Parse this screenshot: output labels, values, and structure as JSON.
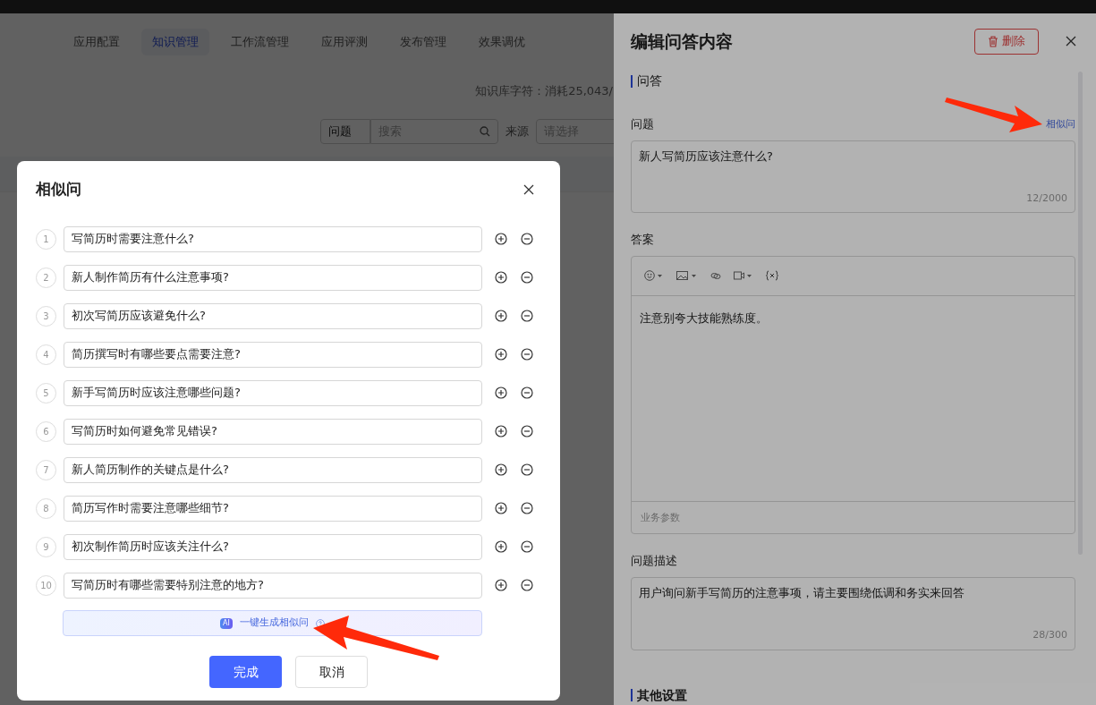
{
  "nav_tabs": [
    {
      "label": "应用配置",
      "selected": false
    },
    {
      "label": "知识管理",
      "selected": true
    },
    {
      "label": "工作流管理",
      "selected": false
    },
    {
      "label": "应用评测",
      "selected": false
    },
    {
      "label": "发布管理",
      "selected": false
    },
    {
      "label": "效果调优",
      "selected": false
    }
  ],
  "usage_text": "知识库字符：消耗25,043/",
  "filter": {
    "type_label": "问题",
    "search_placeholder": "搜索",
    "source_label": "来源",
    "source_placeholder": "请选择"
  },
  "drawer": {
    "title": "编辑问答内容",
    "delete_button": "删除",
    "section_title": "问答",
    "question": {
      "label": "问题",
      "similar_link": "相似问",
      "value": "新人写简历应该注意什么?",
      "counter": "12/2000"
    },
    "answer": {
      "label": "答案",
      "value": "注意别夸大技能熟练度。",
      "footer_hint": "业务参数"
    },
    "description": {
      "label": "问题描述",
      "value": "用户询问新手写简历的注意事项，请主要围绕低调和务实来回答",
      "counter": "28/300"
    },
    "next_section_title": "其他设置"
  },
  "modal": {
    "title": "相似问",
    "items": [
      {
        "index": "1",
        "value": "写简历时需要注意什么?"
      },
      {
        "index": "2",
        "value": "新人制作简历有什么注意事项?"
      },
      {
        "index": "3",
        "value": "初次写简历应该避免什么?"
      },
      {
        "index": "4",
        "value": "简历撰写时有哪些要点需要注意?"
      },
      {
        "index": "5",
        "value": "新手写简历时应该注意哪些问题?"
      },
      {
        "index": "6",
        "value": "写简历时如何避免常见错误?"
      },
      {
        "index": "7",
        "value": "新人简历制作的关键点是什么?"
      },
      {
        "index": "8",
        "value": "简历写作时需要注意哪些细节?"
      },
      {
        "index": "9",
        "value": "初次制作简历时应该关注什么?"
      },
      {
        "index": "10",
        "value": "写简历时有哪些需要特别注意的地方?"
      }
    ],
    "ai_badge": "AI",
    "generate_button": "一键生成相似问",
    "confirm_button": "完成",
    "cancel_button": "取消"
  }
}
